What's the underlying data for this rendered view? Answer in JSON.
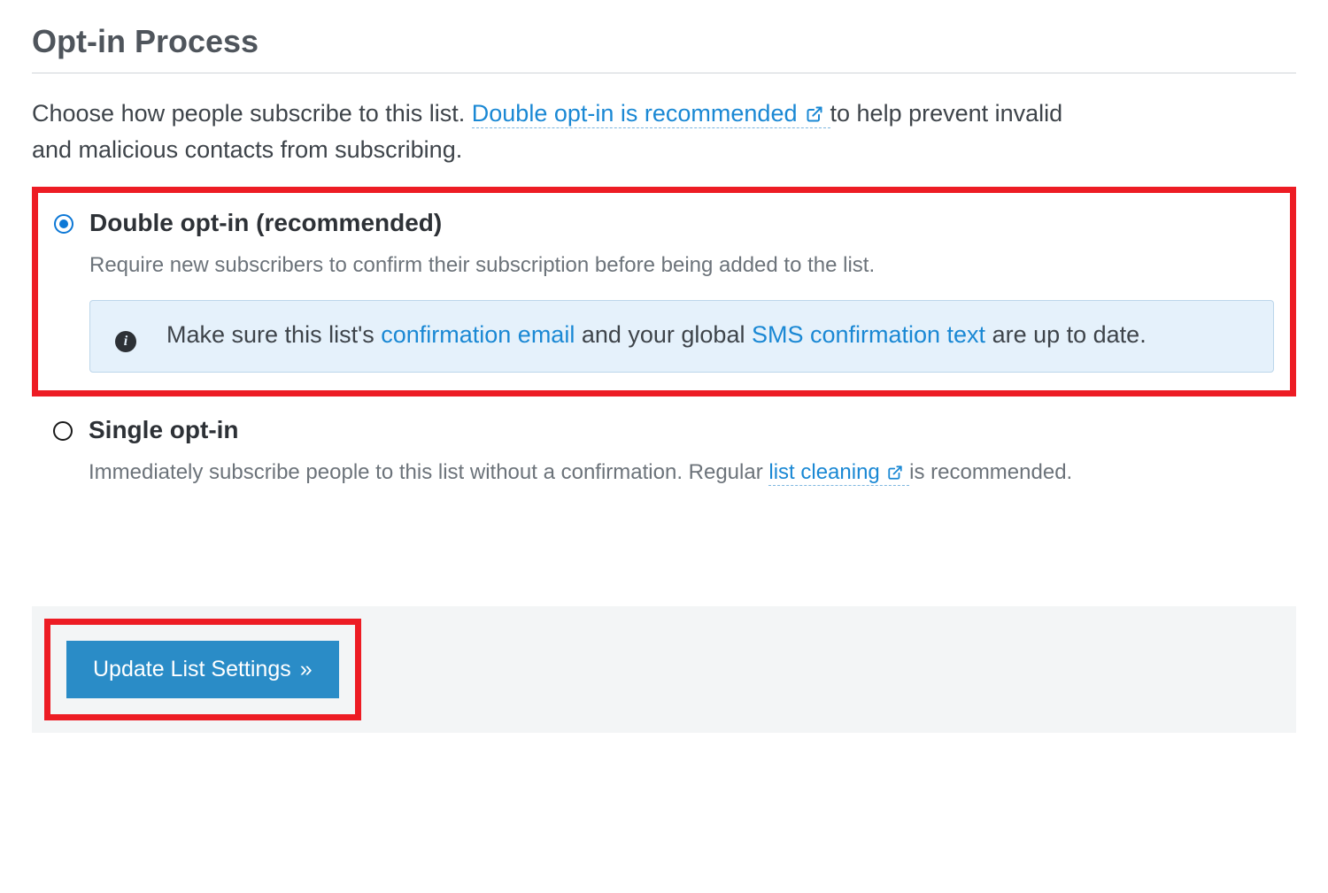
{
  "section": {
    "title": "Opt-in Process",
    "intro_pre": "Choose how people subscribe to this list. ",
    "intro_link": "Double opt-in is recommended",
    "intro_post": " to help prevent invalid and malicious contacts from subscribing."
  },
  "options": {
    "double": {
      "label": "Double opt-in (recommended)",
      "desc": "Require new subscribers to confirm their subscription before being added to the list.",
      "note_pre": "Make sure this list's ",
      "note_link1": "confirmation email",
      "note_mid": " and your global ",
      "note_link2": "SMS confirmation text",
      "note_post": " are up to date."
    },
    "single": {
      "label": "Single opt-in",
      "desc_pre": "Immediately subscribe people to this list without a confirmation. Regular ",
      "desc_link": "list cleaning",
      "desc_post": " is recommended."
    }
  },
  "footer": {
    "button_label": "Update List Settings",
    "button_arrow": "»"
  }
}
